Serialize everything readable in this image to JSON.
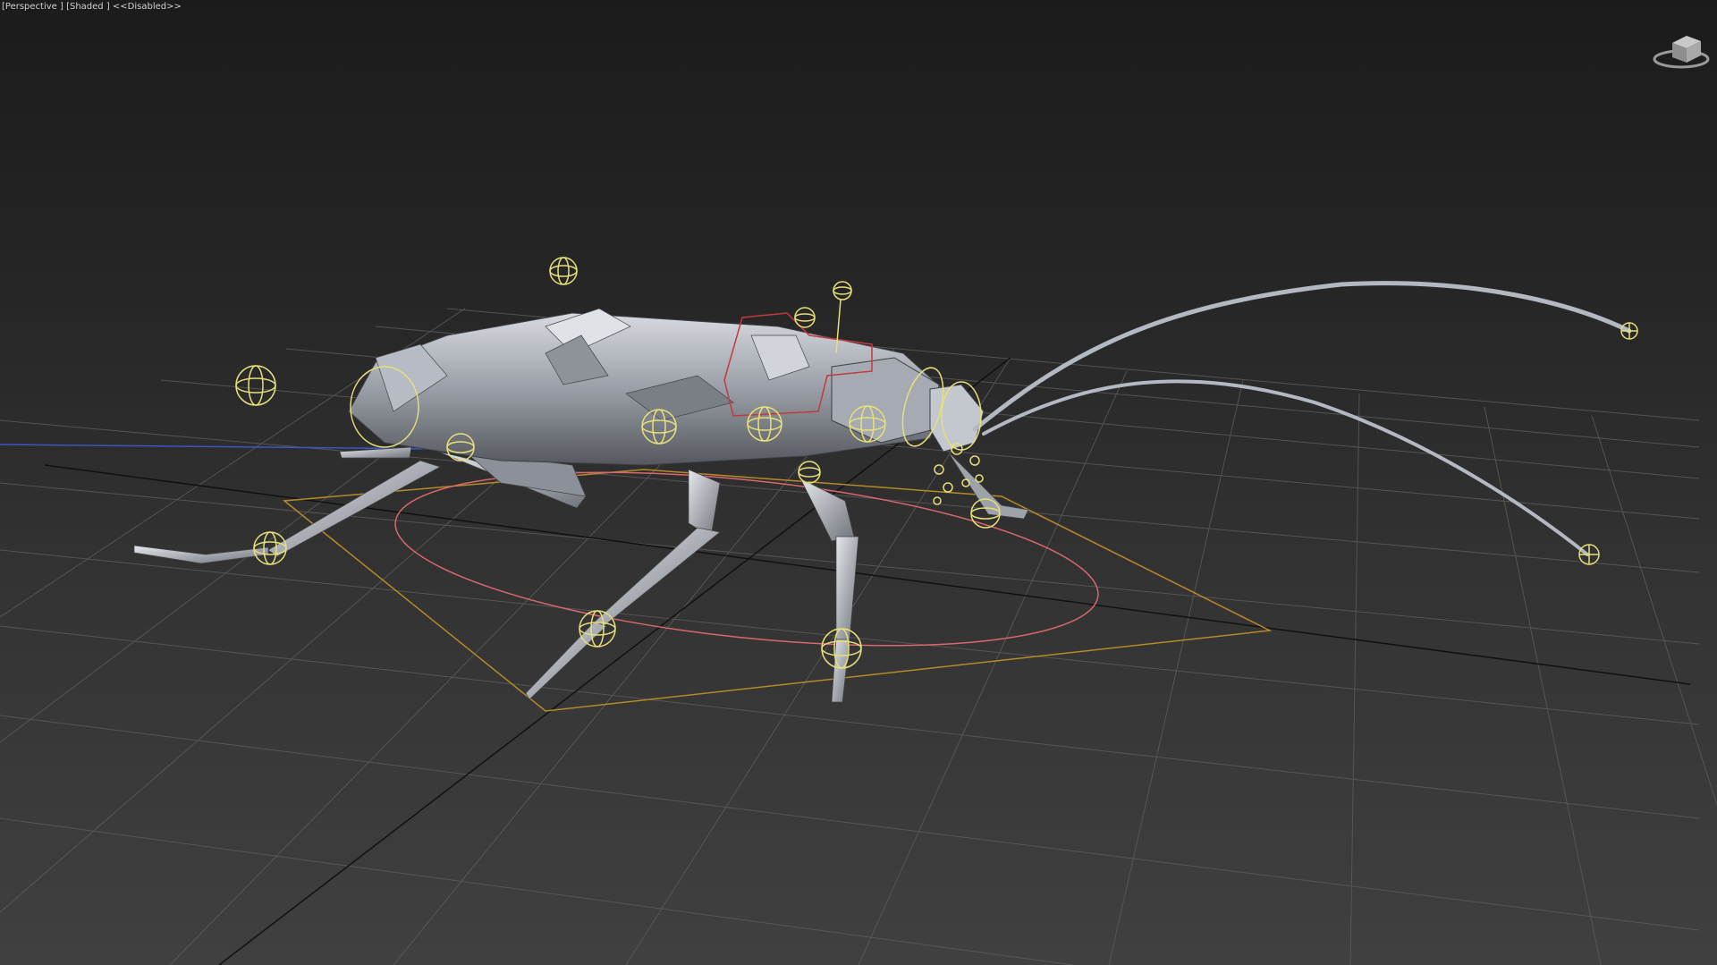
{
  "viewport": {
    "label": "[Perspective ] [Shaded ] <<Disabled>>"
  },
  "icons": {
    "viewcube": "viewcube-icon"
  },
  "colors": {
    "grid": "#5a5a5a",
    "grid_axis": "#111111",
    "mesh_light": "#c8ccd4",
    "mesh_dark": "#6c6f76",
    "control": "#e6e07a",
    "control_red": "#d9676f",
    "control_orange": "#b58a2a",
    "axis_blue": "#3a56c8"
  }
}
